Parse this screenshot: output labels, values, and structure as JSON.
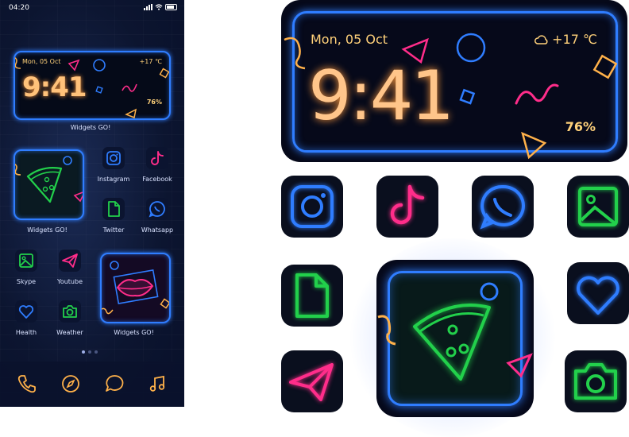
{
  "status_bar": {
    "time": "04:20"
  },
  "clock_widget": {
    "date": "Mon, 05 Oct",
    "weather": "+17 ℃",
    "time": "9:41",
    "battery": "76%"
  },
  "widget_label": "Widgets GO!",
  "phone_apps": [
    {
      "label": "Instagram",
      "icon": "instagram-icon",
      "color": "#2f7dff"
    },
    {
      "label": "Facebook",
      "icon": "tiktok-icon",
      "color": "#ff2d8a"
    },
    {
      "label": "Twitter",
      "icon": "file-icon",
      "color": "#22d04b"
    },
    {
      "label": "Whatsapp",
      "icon": "whatsapp-icon",
      "color": "#2f7dff"
    },
    {
      "label": "Skype",
      "icon": "image-icon",
      "color": "#22d04b"
    },
    {
      "label": "Youtube",
      "icon": "paper-plane-icon",
      "color": "#ff2d8a"
    },
    {
      "label": "Health",
      "icon": "heart-icon",
      "color": "#2f7dff"
    },
    {
      "label": "Weather",
      "icon": "camera-icon",
      "color": "#22d04b"
    }
  ],
  "dock": [
    "phone-icon",
    "compass-icon",
    "chat-icon",
    "music-icon"
  ],
  "colors": {
    "blue": "#2f7dff",
    "pink": "#ff2d8a",
    "green": "#22d04b",
    "orange": "#ffb14a"
  }
}
